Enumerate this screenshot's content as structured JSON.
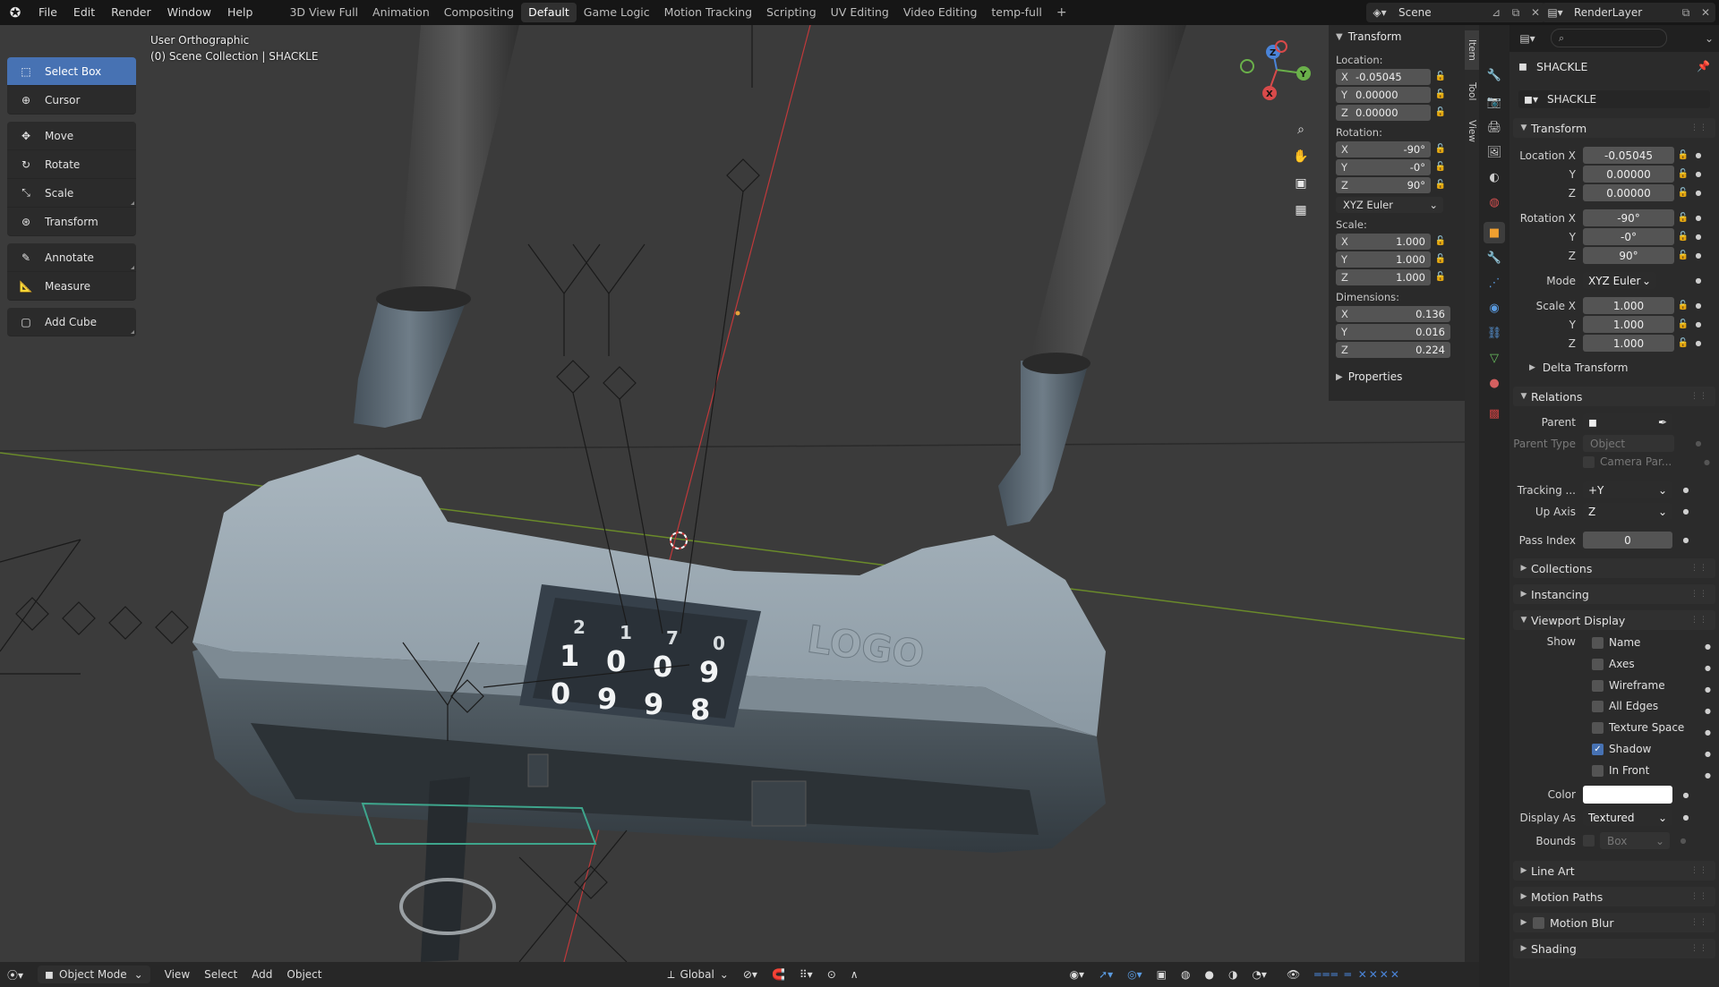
{
  "topbar": {
    "menus": [
      "File",
      "Edit",
      "Render",
      "Window",
      "Help"
    ],
    "workspaces": [
      "3D View Full",
      "Animation",
      "Compositing",
      "Default",
      "Game Logic",
      "Motion Tracking",
      "Scripting",
      "UV Editing",
      "Video Editing",
      "temp-full"
    ],
    "active_workspace": "Default",
    "add_label": "+",
    "scene_name": "Scene",
    "view_layer": "RenderLayer"
  },
  "viewport": {
    "view_name": "User Orthographic",
    "collection_info": "(0) Scene Collection | SHACKLE",
    "logo_text": "LOGO",
    "dials_top": [
      "2",
      "1",
      "7",
      "0"
    ],
    "dials_mid": [
      "1",
      "0",
      "0",
      "9"
    ],
    "dials_bot": [
      "0",
      "9",
      "9",
      "8"
    ]
  },
  "tools": [
    {
      "label": "Select Box",
      "icon": "select-box-icon"
    },
    {
      "label": "Cursor",
      "icon": "cursor-icon"
    },
    {
      "label": "Move",
      "icon": "move-icon"
    },
    {
      "label": "Rotate",
      "icon": "rotate-icon"
    },
    {
      "label": "Scale",
      "icon": "scale-icon"
    },
    {
      "label": "Transform",
      "icon": "transform-icon"
    },
    {
      "label": "Annotate",
      "icon": "annotate-icon"
    },
    {
      "label": "Measure",
      "icon": "measure-icon"
    },
    {
      "label": "Add Cube",
      "icon": "add-cube-icon"
    }
  ],
  "npanel": {
    "header": "Transform",
    "location_label": "Location:",
    "location": [
      {
        "ax": "X",
        "val": "-0.05045"
      },
      {
        "ax": "Y",
        "val": "0.00000"
      },
      {
        "ax": "Z",
        "val": "0.00000"
      }
    ],
    "rotation_label": "Rotation:",
    "rotation": [
      {
        "ax": "X",
        "val": "-90°"
      },
      {
        "ax": "Y",
        "val": "-0°"
      },
      {
        "ax": "Z",
        "val": "90°"
      }
    ],
    "rotation_mode": "XYZ Euler",
    "scale_label": "Scale:",
    "scale": [
      {
        "ax": "X",
        "val": "1.000"
      },
      {
        "ax": "Y",
        "val": "1.000"
      },
      {
        "ax": "Z",
        "val": "1.000"
      }
    ],
    "dimensions_label": "Dimensions:",
    "dimensions": [
      {
        "ax": "X",
        "val": "0.136"
      },
      {
        "ax": "Y",
        "val": "0.016"
      },
      {
        "ax": "Z",
        "val": "0.224"
      }
    ],
    "properties_label": "Properties",
    "tabs": [
      "Item",
      "Tool",
      "View"
    ]
  },
  "props": {
    "object_name": "SHACKLE",
    "object_field": "SHACKLE",
    "transform_header": "Transform",
    "location_x_label": "Location X",
    "location_x": "-0.05045",
    "y_label": "Y",
    "location_y": "0.00000",
    "z_label": "Z",
    "location_z": "0.00000",
    "rotation_x_label": "Rotation X",
    "rotation_x": "-90°",
    "rotation_y": "-0°",
    "rotation_z": "90°",
    "mode_label": "Mode",
    "mode_value": "XYZ Euler",
    "scale_x_label": "Scale X",
    "scale_x": "1.000",
    "scale_y": "1.000",
    "scale_z": "1.000",
    "delta_transform": "Delta Transform",
    "relations_header": "Relations",
    "parent_label": "Parent",
    "parent_type_label": "Parent Type",
    "parent_type_value": "Object",
    "camera_parent": "Camera Par...",
    "tracking_label": "Tracking ...",
    "tracking_value": "+Y",
    "up_axis_label": "Up Axis",
    "up_axis_value": "Z",
    "pass_index_label": "Pass Index",
    "pass_index_value": "0",
    "collections": "Collections",
    "instancing": "Instancing",
    "viewport_display": "Viewport Display",
    "show_label": "Show",
    "show_items": [
      {
        "label": "Name",
        "checked": false
      },
      {
        "label": "Axes",
        "checked": false
      },
      {
        "label": "Wireframe",
        "checked": false
      },
      {
        "label": "All Edges",
        "checked": false
      },
      {
        "label": "Texture Space",
        "checked": false
      },
      {
        "label": "Shadow",
        "checked": true
      },
      {
        "label": "In Front",
        "checked": false
      }
    ],
    "color_label": "Color",
    "display_as_label": "Display As",
    "display_as_value": "Textured",
    "bounds_label": "Bounds",
    "bounds_value": "Box",
    "line_art": "Line Art",
    "motion_paths": "Motion Paths",
    "motion_blur": "Motion Blur",
    "shading": "Shading",
    "search_placeholder": "⌕"
  },
  "bottombar": {
    "mode": "Object Mode",
    "menus": [
      "View",
      "Select",
      "Add",
      "Object"
    ],
    "orientation": "Global"
  }
}
